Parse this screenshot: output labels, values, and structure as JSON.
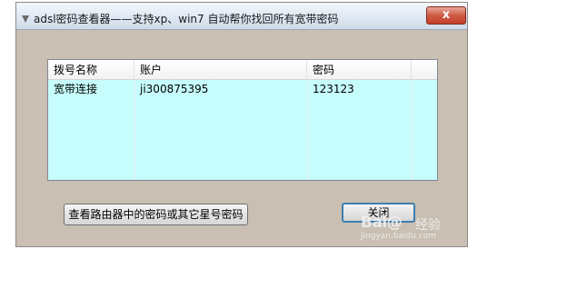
{
  "window": {
    "title": "adsl密码查看器——支持xp、win7 自动帮你找回所有宽带密码",
    "close_glyph": "x"
  },
  "table": {
    "columns": [
      "拨号名称",
      "账户",
      "密码"
    ],
    "rows": [
      [
        "宽带连接",
        "ji300875395",
        "123123"
      ]
    ],
    "row_background": "#c6fcfc"
  },
  "buttons": {
    "router_label": "查看路由器中的密码或其它星号密码",
    "close_label": "关闭"
  },
  "watermark": {
    "logo": "Bai@",
    "sub": "经验",
    "url": "jingyan.baidu.com"
  }
}
